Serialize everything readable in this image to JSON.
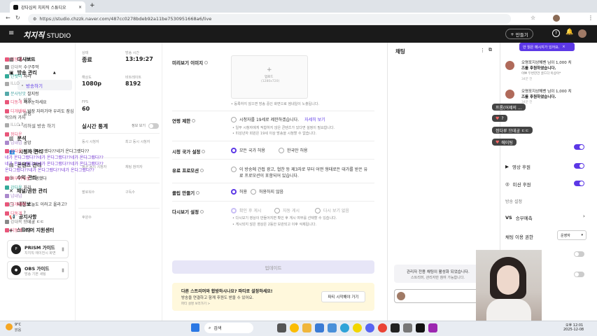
{
  "browser": {
    "tab_title": "강다심의 치지직 스튜디오",
    "url": "https://studio.chzzk.naver.com/487cc0278bdeb92a11be7530951668a6/live"
  },
  "header": {
    "brand": "치지직",
    "brand_sub": "STUDIO",
    "create_label": "만들기"
  },
  "sidebar": {
    "items": [
      {
        "label": "대시보드"
      },
      {
        "label": "방송 관리"
      },
      {
        "label": "분석"
      },
      {
        "label": "시청자 관리"
      },
      {
        "label": "콘텐츠 관리"
      },
      {
        "label": "수익 관리"
      },
      {
        "label": "채널/권한 관리"
      },
      {
        "label": "내정보"
      },
      {
        "label": "공지사항"
      },
      {
        "label": "스트리머 지원센터"
      }
    ],
    "sub": [
      {
        "label": "방송하기"
      },
      {
        "label": "설정"
      },
      {
        "label": "알림"
      },
      {
        "label": "리허설 방송 하기"
      }
    ],
    "guides": [
      {
        "title": "PRISM 가이드",
        "desc": "치지직 에이전시 화면"
      },
      {
        "title": "OBS 가이드",
        "desc": "방송 기본 세팅"
      }
    ]
  },
  "stats": {
    "status_label": "상태",
    "status": "종료",
    "time_label": "방송 시간",
    "time": "13:19:27",
    "res_label": "해상도",
    "res": "1080p",
    "bitrate_label": "비트레이트",
    "bitrate": "8192",
    "fps_label": "FPS",
    "fps": "60",
    "realtime_title": "실시간 통계",
    "info_toggle": "정보 보기",
    "rt": [
      {
        "a": "동시 시청자",
        "b": "최고 동시 시청자"
      },
      {
        "a": "평균 동시 시청자",
        "b": "채팅 참여자"
      },
      {
        "a": "팔로워수",
        "b": "구독수"
      },
      {
        "a": "후원수",
        "b": ""
      }
    ]
  },
  "form": {
    "preview_label": "미리보기 이미지",
    "upload": "업로드",
    "upload_size": "(1280x720)",
    "preview_note": "• 등록하지 않으면 방송 중인 화면으로 썸네일이 노출됩니다.",
    "age_label": "연령 제한",
    "age_option": "시청자를 19세로 제한하겠습니다.",
    "age_link": "자세히 보기",
    "age_note1": "• 일부 시청자에게 적합하지 않은 콘텐츠가 있다면 설정이 필요합니다.",
    "age_note2": "• 미성년자 회원은 19세 이상 방송을 시청할 수 없습니다.",
    "country_label": "시청 국가 설정",
    "country_all": "모든 국가 허용",
    "country_kr": "한국만 허용",
    "paid_label": "유료 프로모션",
    "paid_text1": "이 방송에 간접 광고, 협찬 등 제3자로 부터 어떤 형태로든 대가를 받은 유",
    "paid_text2": "료 프로모션이 포함되어 있습니다.",
    "clip_label": "클립 만들기",
    "clip_allow": "허용",
    "clip_deny": "허용하지 않음",
    "replay_label": "다시보기 설정",
    "replay_o1": "확인 후 게시",
    "replay_o2": "자동 게시",
    "replay_o3": "다시 보기 없음",
    "replay_note1": "• 다시보기 영상이 만들어지면 확인 후 게시 여부를 선택할 수 있습니다.",
    "replay_note2": "• 게시되지 않은 영상은 2동안 보관되고 이후 삭제됩니다.",
    "update": "업데이트",
    "promo_title": "다른 스트리머와 합방하시나요? 파티로 설정하세요!",
    "promo_desc": "방송을 연결하고 함께 후원도 받을 수 있어요.",
    "promo_link": "파티 설명 보러가기 >",
    "promo_btn": "파티 시작해야 가기"
  },
  "chat": {
    "title": "채팅",
    "lines": [
      {
        "name": "디동개",
        "text": "거북이",
        "color": "#e8567a"
      },
      {
        "name": "강대복",
        "text": "수구주먹",
        "color": "#888"
      },
      {
        "name": "단뱃이",
        "text": "자라",
        "color": "#3a9"
      },
      {
        "name": "ILLO",
        "text": "",
        "color": "#aaa"
      },
      {
        "name": "분사탕맛",
        "text": "찰지렁",
        "color": "#5aa"
      },
      {
        "name": "디동개",
        "text": "재수눈하세요",
        "color": "#e8567a"
      },
      {
        "name": "디개배배",
        "text": "방장 자러가야 우리도 잠심",
        "color": "#e8567a"
      },
      {
        "name": "",
        "text": "먹으러 가자",
        "color": "#333"
      },
      {
        "name": "ILLO",
        "text": "?",
        "color": "#aaa"
      },
      {
        "name": "정다운",
        "text": "",
        "color": "#e8567a"
      },
      {
        "name": "넘내넘",
        "text": "궁앙",
        "color": "#a8c"
      },
      {
        "name": "정다운",
        "text": "네가 온다그랬다??네가 온다그랬다??",
        "color": "#e8567a"
      },
      {
        "name": "",
        "text": "네가 온다그랬다??네가 온다그랬다??네가 온다그랬다??",
        "color": "#7a3fd6"
      },
      {
        "name": "",
        "text": "네가 온다그랬다??네가 온다그랬다??네가 온다그랬다??",
        "color": "#7a3fd6"
      },
      {
        "name": "",
        "text": "온다그랬다??네가 온다그랬다??네가 온다그랬다??",
        "color": "#7a3fd6"
      },
      {
        "name": "아우아우샹",
        "text": "고생했다",
        "color": "#e8567a"
      },
      {
        "name": "강다윤",
        "text": "자라",
        "color": "#3a9"
      },
      {
        "name": "넘내넘",
        "text": "",
        "color": "#a8c"
      },
      {
        "name": "디개배배",
        "text": "오늘도 이러고 올라고?",
        "color": "#e8567a"
      },
      {
        "name": "디동개",
        "text": "?",
        "color": "#e8567a"
      },
      {
        "name": "강대복",
        "text": "므데궁 ㄷㄷ",
        "color": "#888"
      },
      {
        "name": "디동개",
        "text": "예예!",
        "color": "#e8567a"
      }
    ],
    "notice1": "관리자 전용 채팅이 활성화 되었습니다.",
    "notice2": "스트리머, 관리자만 참여 가능합니다."
  },
  "right": {
    "badge": "안 읽은 메시지가 있어요.",
    "n1a": "오명포지상해벤 님이 1,000 치",
    "n1b": "즈를 후원하였습니다.",
    "n1c": "이쁘 두번한건 골드다 이상이*",
    "n1d": "34분 전",
    "n2a": "오명포지상해벤 님이 1,000 치",
    "n2b": "즈를 후원하였습니다.",
    "n2c": "34분 전",
    "video_donation": "영상 후원",
    "mission": "미션 후원",
    "settings_title": "방송 설정",
    "predict": "승부예측",
    "chat_perm": "채팅 이용 권한",
    "chat_perm_value": "운영자"
  },
  "overlay": {
    "p1": "프롬(어제의 ...",
    "p2": "?",
    "p3": "정다루 므데궁 ㄷㄷ",
    "p4": "에이팅"
  },
  "taskbar": {
    "weather": "9°C",
    "weather_desc": "맑음",
    "search": "검색",
    "time": "오후 12:01",
    "date": "2025-12-08"
  }
}
